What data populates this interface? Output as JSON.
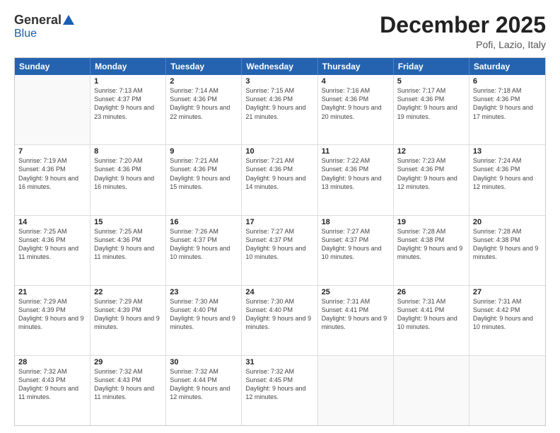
{
  "header": {
    "logo_general": "General",
    "logo_blue": "Blue",
    "month_title": "December 2025",
    "location": "Pofi, Lazio, Italy"
  },
  "days_of_week": [
    "Sunday",
    "Monday",
    "Tuesday",
    "Wednesday",
    "Thursday",
    "Friday",
    "Saturday"
  ],
  "weeks": [
    [
      {
        "day": "",
        "sunrise": "",
        "sunset": "",
        "daylight": ""
      },
      {
        "day": "1",
        "sunrise": "7:13 AM",
        "sunset": "4:37 PM",
        "daylight": "9 hours and 23 minutes."
      },
      {
        "day": "2",
        "sunrise": "7:14 AM",
        "sunset": "4:36 PM",
        "daylight": "9 hours and 22 minutes."
      },
      {
        "day": "3",
        "sunrise": "7:15 AM",
        "sunset": "4:36 PM",
        "daylight": "9 hours and 21 minutes."
      },
      {
        "day": "4",
        "sunrise": "7:16 AM",
        "sunset": "4:36 PM",
        "daylight": "9 hours and 20 minutes."
      },
      {
        "day": "5",
        "sunrise": "7:17 AM",
        "sunset": "4:36 PM",
        "daylight": "9 hours and 19 minutes."
      },
      {
        "day": "6",
        "sunrise": "7:18 AM",
        "sunset": "4:36 PM",
        "daylight": "9 hours and 17 minutes."
      }
    ],
    [
      {
        "day": "7",
        "sunrise": "7:19 AM",
        "sunset": "4:36 PM",
        "daylight": "9 hours and 16 minutes."
      },
      {
        "day": "8",
        "sunrise": "7:20 AM",
        "sunset": "4:36 PM",
        "daylight": "9 hours and 16 minutes."
      },
      {
        "day": "9",
        "sunrise": "7:21 AM",
        "sunset": "4:36 PM",
        "daylight": "9 hours and 15 minutes."
      },
      {
        "day": "10",
        "sunrise": "7:21 AM",
        "sunset": "4:36 PM",
        "daylight": "9 hours and 14 minutes."
      },
      {
        "day": "11",
        "sunrise": "7:22 AM",
        "sunset": "4:36 PM",
        "daylight": "9 hours and 13 minutes."
      },
      {
        "day": "12",
        "sunrise": "7:23 AM",
        "sunset": "4:36 PM",
        "daylight": "9 hours and 12 minutes."
      },
      {
        "day": "13",
        "sunrise": "7:24 AM",
        "sunset": "4:36 PM",
        "daylight": "9 hours and 12 minutes."
      }
    ],
    [
      {
        "day": "14",
        "sunrise": "7:25 AM",
        "sunset": "4:36 PM",
        "daylight": "9 hours and 11 minutes."
      },
      {
        "day": "15",
        "sunrise": "7:25 AM",
        "sunset": "4:36 PM",
        "daylight": "9 hours and 11 minutes."
      },
      {
        "day": "16",
        "sunrise": "7:26 AM",
        "sunset": "4:37 PM",
        "daylight": "9 hours and 10 minutes."
      },
      {
        "day": "17",
        "sunrise": "7:27 AM",
        "sunset": "4:37 PM",
        "daylight": "9 hours and 10 minutes."
      },
      {
        "day": "18",
        "sunrise": "7:27 AM",
        "sunset": "4:37 PM",
        "daylight": "9 hours and 10 minutes."
      },
      {
        "day": "19",
        "sunrise": "7:28 AM",
        "sunset": "4:38 PM",
        "daylight": "9 hours and 9 minutes."
      },
      {
        "day": "20",
        "sunrise": "7:28 AM",
        "sunset": "4:38 PM",
        "daylight": "9 hours and 9 minutes."
      }
    ],
    [
      {
        "day": "21",
        "sunrise": "7:29 AM",
        "sunset": "4:39 PM",
        "daylight": "9 hours and 9 minutes."
      },
      {
        "day": "22",
        "sunrise": "7:29 AM",
        "sunset": "4:39 PM",
        "daylight": "9 hours and 9 minutes."
      },
      {
        "day": "23",
        "sunrise": "7:30 AM",
        "sunset": "4:40 PM",
        "daylight": "9 hours and 9 minutes."
      },
      {
        "day": "24",
        "sunrise": "7:30 AM",
        "sunset": "4:40 PM",
        "daylight": "9 hours and 9 minutes."
      },
      {
        "day": "25",
        "sunrise": "7:31 AM",
        "sunset": "4:41 PM",
        "daylight": "9 hours and 9 minutes."
      },
      {
        "day": "26",
        "sunrise": "7:31 AM",
        "sunset": "4:41 PM",
        "daylight": "9 hours and 10 minutes."
      },
      {
        "day": "27",
        "sunrise": "7:31 AM",
        "sunset": "4:42 PM",
        "daylight": "9 hours and 10 minutes."
      }
    ],
    [
      {
        "day": "28",
        "sunrise": "7:32 AM",
        "sunset": "4:43 PM",
        "daylight": "9 hours and 11 minutes."
      },
      {
        "day": "29",
        "sunrise": "7:32 AM",
        "sunset": "4:43 PM",
        "daylight": "9 hours and 11 minutes."
      },
      {
        "day": "30",
        "sunrise": "7:32 AM",
        "sunset": "4:44 PM",
        "daylight": "9 hours and 12 minutes."
      },
      {
        "day": "31",
        "sunrise": "7:32 AM",
        "sunset": "4:45 PM",
        "daylight": "9 hours and 12 minutes."
      },
      {
        "day": "",
        "sunrise": "",
        "sunset": "",
        "daylight": ""
      },
      {
        "day": "",
        "sunrise": "",
        "sunset": "",
        "daylight": ""
      },
      {
        "day": "",
        "sunrise": "",
        "sunset": "",
        "daylight": ""
      }
    ]
  ]
}
